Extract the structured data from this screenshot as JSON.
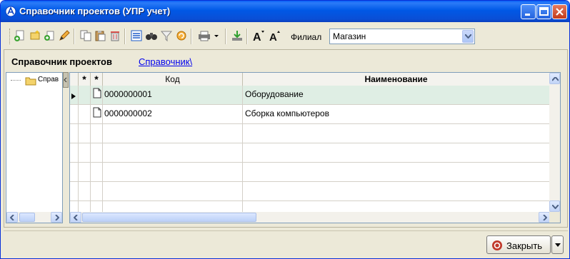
{
  "window": {
    "title": "Справочник проектов (УПР учет)",
    "controls": [
      "minimize-icon",
      "maximize-icon",
      "close-icon"
    ]
  },
  "toolbar": {
    "icons": [
      "add-item-icon",
      "add-folder-icon",
      "add-copy-icon",
      "edit-pencil-icon",
      "copy-icon",
      "paste-icon",
      "delete-icon",
      "list-view-icon",
      "binoculars-search-icon",
      "filter-icon",
      "refresh-icon",
      "print-icon",
      "export-download-icon",
      "font-increase-icon",
      "font-decrease-icon"
    ],
    "branch_label": "Филиал",
    "branch_value": "Магазин"
  },
  "panel": {
    "title": "Справочник проектов",
    "breadcrumb_link": "Справочник\\"
  },
  "tree": {
    "items": [
      {
        "label": "Справ"
      }
    ]
  },
  "grid": {
    "columns": {
      "mark1": "*",
      "mark2": "*",
      "code": "Код",
      "name": "Наименование"
    },
    "rows": [
      {
        "code": "0000000001",
        "name": "Оборудование",
        "selected": true
      },
      {
        "code": "0000000002",
        "name": "Сборка компьютеров",
        "selected": false
      }
    ]
  },
  "footer": {
    "close_label": "Закрыть"
  },
  "colors": {
    "titlebar": "#0058e6",
    "window_bg": "#ece9d8",
    "selected_row": "#dfeee4",
    "link": "#0000ee"
  }
}
